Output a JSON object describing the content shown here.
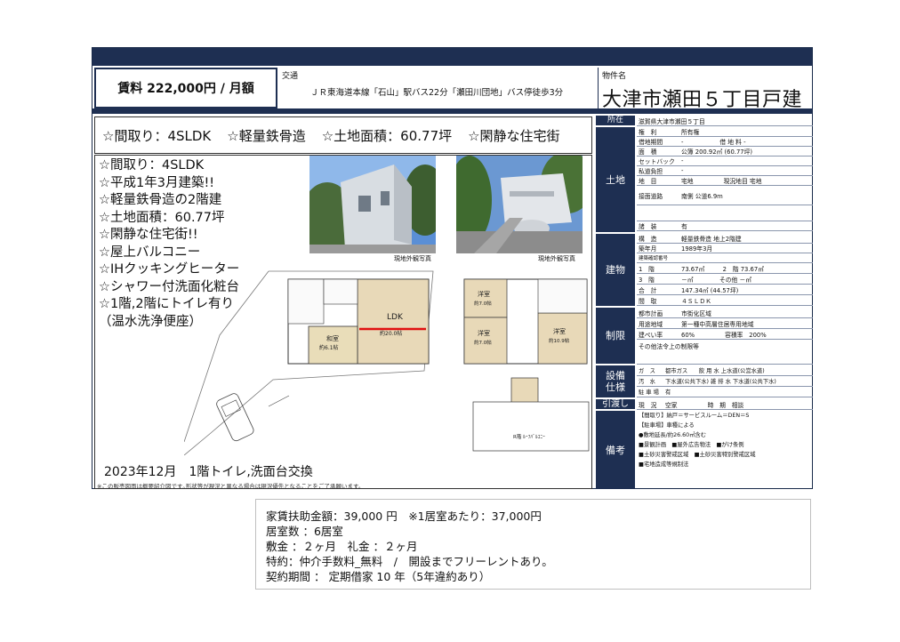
{
  "header": {
    "rent": "賃料 222,000円 / 月額",
    "access_label": "交通",
    "access_value": "ＪＲ東海道本線「石山」駅バス22分「瀬田川団地」バス停徒歩3分",
    "name_label": "物件名",
    "name_value": "大津市瀬田５丁目戸建"
  },
  "features_strip": [
    "☆間取り：4SLDK",
    "☆軽量鉄骨造",
    "☆土地面積：60.77坪",
    "☆閑静な住宅街"
  ],
  "features_list": [
    "☆間取り：4SLDK",
    "☆平成1年3月建築!!",
    "☆軽量鉄骨造の2階建",
    "☆土地面積：60.77坪",
    "☆閑静な住宅街!!",
    "☆屋上バルコニー",
    "☆IHクッキングヒーター",
    "☆シャワー付洗面化粧台",
    "☆1階,2階にトイレ有り",
    "（温水洗浄便座）"
  ],
  "photos": {
    "caption1": "現地外観写真",
    "caption2": "現地外観写真"
  },
  "floorplan": {
    "ldk": "LDK",
    "ldk_size": "約20.0帖",
    "washitsu": "和室",
    "washitsu_size": "約6.1帖",
    "yoshitsu1": "洋室",
    "yoshitsu1_size": "約7.0帖",
    "yoshitsu2": "洋室",
    "yoshitsu2_size": "約7.0帖",
    "yoshitsu3": "洋室",
    "yoshitsu3_size": "約10.9帖",
    "rooftop": "R階 ﾙｰﾌﾊﾞﾙｺﾆｰ"
  },
  "bottom_note": "2023年12月　1階トイレ,洗面台交換",
  "small_note": "※この販売図面は概要紹介図です｡形状等が現況と異なる場合は現況優先となることをご了承願います。",
  "spec": {
    "shozai_label": "所在",
    "shozai_value": "滋賀県大津市瀬田５丁目",
    "tochi_label": "土地",
    "tochi_rows": [
      {
        "k": "権　利",
        "v": "所有権"
      },
      {
        "k": "借地期間",
        "v": "-　　　　　　借 地 料 -"
      },
      {
        "k": "面　積",
        "v": "公簿 200.92㎡ (60.77坪)"
      },
      {
        "k": "セットバック",
        "v": "-"
      },
      {
        "k": "私道負担",
        "v": "-"
      },
      {
        "k": "地　目",
        "v": "宅地　　　　　現況地目 宅地"
      },
      {
        "k": "接面道路",
        "v": "南側 公道6.9m"
      },
      {
        "k": "",
        "v": ""
      },
      {
        "k": "諸　装",
        "v": "有"
      }
    ],
    "tatemono_label": "建物",
    "tatemono_rows": [
      {
        "k": "構　造",
        "v": "軽量鉄骨造 地上2階建"
      },
      {
        "k": "築年月",
        "v": "1989年3月"
      },
      {
        "k": "建築確認番号",
        "v": ""
      },
      {
        "k": "1　階",
        "v": "73.67㎡　　　2　階 73.67㎡"
      },
      {
        "k": "3　階",
        "v": "－㎡　　　　 その他 －㎡"
      },
      {
        "k": "合　計",
        "v": "147.34㎡ (44.57坪)"
      },
      {
        "k": "間　取",
        "v": "４ＳＬＤＫ"
      }
    ],
    "seigen_label": "制限",
    "seigen_rows": [
      {
        "k": "都市計画",
        "v": "市街化区域"
      },
      {
        "k": "用途地域",
        "v": "第一種中高層住居専用地域"
      },
      {
        "k": "建ぺい率",
        "v": "60%　　　　　容積率　200%"
      },
      {
        "k": "その他法令上の制限等",
        "v": ""
      }
    ],
    "setsubi_label": "設備\n仕様",
    "setsubi_rows": [
      {
        "k": "ガ　ス",
        "v": "都市ガス　　飲 用 水 上水道(公営水道)"
      },
      {
        "k": "汚　水",
        "v": "下水道(公共下水) 雑 排 水 下水道(公共下水)"
      },
      {
        "k": "駐 車 場",
        "v": "有"
      }
    ],
    "hikiwatashi_label": "引渡し",
    "hikiwatashi_row": {
      "k": "現　況",
      "v": "空家　　　　　時　期　相談"
    },
    "biko_label": "備考",
    "biko_rows": [
      "【間取り】納戸＝サービスルーム＝DEN＝S",
      "【駐車場】車種による",
      "●敷地延長/約26.60㎡含む",
      "■景観計画　■屋外広告物法　■がけ条例",
      "■土砂災害警戒区域　■土砂災害特別警戒区域",
      "■宅地造成等規制法"
    ]
  },
  "info": {
    "line1": "家賃扶助金額：39,000 円　※1居室あたり：37,000円",
    "line2": "居室数 ：6居室",
    "line3": "敷金 ：２ヶ月　礼金 ：２ヶ月",
    "line4": "特約：仲介手数料_無料　/　開設までフリーレントあり。",
    "line5": "契約期間 ： 定期借家 10 年（5年違約あり）"
  }
}
